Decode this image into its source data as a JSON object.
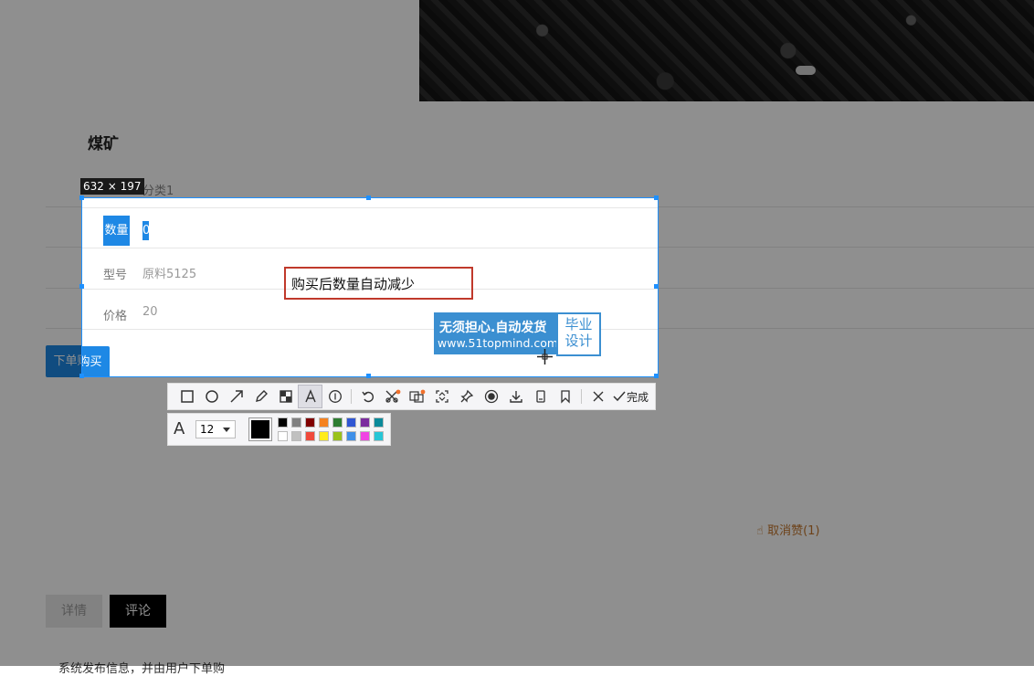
{
  "product": {
    "title": "煤矿",
    "category": "分类1",
    "quantity_label": "数量",
    "quantity_value": "0",
    "model_label": "型号",
    "model_value": "原料5125",
    "price_label": "价格",
    "price_value": "20",
    "buy_button": "下单购买",
    "like_text": "取消赞(1)"
  },
  "tabs": {
    "details": "详情",
    "comments": "评论"
  },
  "bottom_text": "系统发布信息，并由用户下单购",
  "capture": {
    "size_label": "632 × 197",
    "annotation_text": "购买后数量自动减少",
    "done_label": "完成",
    "font_size": "12",
    "current_color": "#000000",
    "palette": [
      "#000000",
      "#808080",
      "#800000",
      "#f58220",
      "#2e7d32",
      "#3056d3",
      "#7b2c9e",
      "#0b8a9a",
      "#ffffff",
      "#c0c0c0",
      "#f04a3c",
      "#ffec1a",
      "#9ac21a",
      "#3f8fe8",
      "#f043e3",
      "#27c6d6"
    ],
    "tools": [
      "rectangle-icon",
      "ellipse-icon",
      "arrow-icon",
      "pencil-icon",
      "mosaic-icon",
      "text-icon",
      "number-icon",
      "undo-icon",
      "ocr-icon",
      "translate-icon",
      "scroll-capture-icon",
      "pin-icon",
      "record-icon",
      "download-icon",
      "device-icon",
      "bookmark-icon",
      "close-icon"
    ]
  },
  "watermark": {
    "line1": "无须担心.自动发货",
    "line2": "www.51topmind.com",
    "right_top": "毕业",
    "right_bottom": "设计"
  }
}
